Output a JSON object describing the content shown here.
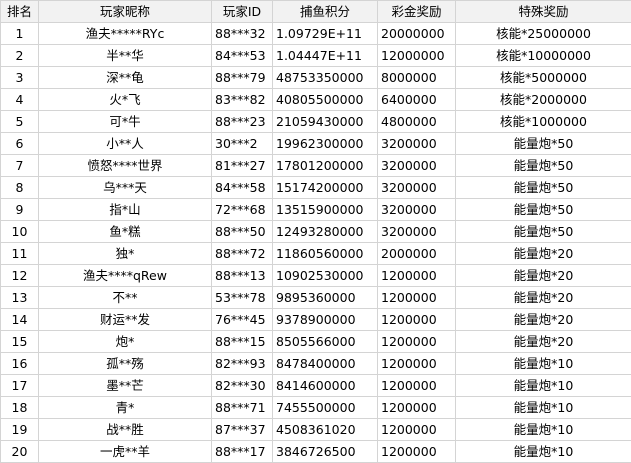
{
  "table": {
    "headers": {
      "rank": "排名",
      "nickname": "玩家昵称",
      "player_id": "玩家ID",
      "score": "捕鱼积分",
      "prize": "彩金奖励",
      "special": "特殊奖励"
    },
    "rows": [
      {
        "rank": "1",
        "nickname": "渔夫*****RYc",
        "player_id": "88***32",
        "score": "1.09729E+11",
        "prize": "20000000",
        "special": "核能*25000000"
      },
      {
        "rank": "2",
        "nickname": "半**华",
        "player_id": "84***53",
        "score": "1.04447E+11",
        "prize": "12000000",
        "special": "核能*10000000"
      },
      {
        "rank": "3",
        "nickname": "深**龟",
        "player_id": "88***79",
        "score": "48753350000",
        "prize": "8000000",
        "special": "核能*5000000"
      },
      {
        "rank": "4",
        "nickname": "火*飞",
        "player_id": "83***82",
        "score": "40805500000",
        "prize": "6400000",
        "special": "核能*2000000"
      },
      {
        "rank": "5",
        "nickname": "可*牛",
        "player_id": "88***23",
        "score": "21059430000",
        "prize": "4800000",
        "special": "核能*1000000"
      },
      {
        "rank": "6",
        "nickname": "小**人",
        "player_id": "30***2",
        "score": "19962300000",
        "prize": "3200000",
        "special": "能量炮*50"
      },
      {
        "rank": "7",
        "nickname": "愤怒****世界",
        "player_id": "81***27",
        "score": "17801200000",
        "prize": "3200000",
        "special": "能量炮*50"
      },
      {
        "rank": "8",
        "nickname": "乌***天",
        "player_id": "84***58",
        "score": "15174200000",
        "prize": "3200000",
        "special": "能量炮*50"
      },
      {
        "rank": "9",
        "nickname": "指*山",
        "player_id": "72***68",
        "score": "13515900000",
        "prize": "3200000",
        "special": "能量炮*50"
      },
      {
        "rank": "10",
        "nickname": "鱼*糕",
        "player_id": "88***50",
        "score": "12493280000",
        "prize": "3200000",
        "special": "能量炮*50"
      },
      {
        "rank": "11",
        "nickname": "独*",
        "player_id": "88***72",
        "score": "11860560000",
        "prize": "2000000",
        "special": "能量炮*20"
      },
      {
        "rank": "12",
        "nickname": "渔夫****qRew",
        "player_id": "88***13",
        "score": "10902530000",
        "prize": "1200000",
        "special": "能量炮*20"
      },
      {
        "rank": "13",
        "nickname": "不**",
        "player_id": "53***78",
        "score": "9895360000",
        "prize": "1200000",
        "special": "能量炮*20"
      },
      {
        "rank": "14",
        "nickname": "财运**发",
        "player_id": "76***45",
        "score": "9378900000",
        "prize": "1200000",
        "special": "能量炮*20"
      },
      {
        "rank": "15",
        "nickname": "炮*",
        "player_id": "88***15",
        "score": "8505566000",
        "prize": "1200000",
        "special": "能量炮*20"
      },
      {
        "rank": "16",
        "nickname": "孤**殇",
        "player_id": "82***93",
        "score": "8478400000",
        "prize": "1200000",
        "special": "能量炮*10"
      },
      {
        "rank": "17",
        "nickname": "墨**芒",
        "player_id": "82***30",
        "score": "8414600000",
        "prize": "1200000",
        "special": "能量炮*10"
      },
      {
        "rank": "18",
        "nickname": "青*",
        "player_id": "88***71",
        "score": "7455500000",
        "prize": "1200000",
        "special": "能量炮*10"
      },
      {
        "rank": "19",
        "nickname": "战**胜",
        "player_id": "87***37",
        "score": "4508361020",
        "prize": "1200000",
        "special": "能量炮*10"
      },
      {
        "rank": "20",
        "nickname": "一虎**羊",
        "player_id": "88***17",
        "score": "3846726500",
        "prize": "1200000",
        "special": "能量炮*10"
      }
    ]
  }
}
